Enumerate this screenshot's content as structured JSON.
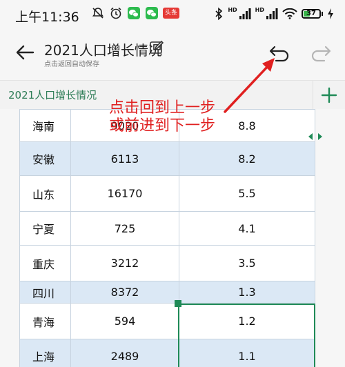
{
  "status_bar": {
    "time": "上午11:36",
    "app_badge": "头条",
    "signal1_label": "HD",
    "signal2_label": "HD",
    "battery_level": "37",
    "battery_fraction": 0.37,
    "icons": [
      "mute-bell-icon",
      "alarm-icon",
      "wechat-icon",
      "news-app-icon",
      "bluetooth-icon",
      "signal-icon",
      "wifi-icon",
      "battery-icon",
      "charging-icon"
    ]
  },
  "header": {
    "title": "2021人口增长情况",
    "subtitle": "点击返回自动保存"
  },
  "tabs": [
    {
      "label": "2021人口增长情况"
    }
  ],
  "table": {
    "rows": [
      {
        "name": "海南",
        "population": "9020",
        "rate": "8.8"
      },
      {
        "name": "安徽",
        "population": "6113",
        "rate": "8.2"
      },
      {
        "name": "山东",
        "population": "16170",
        "rate": "5.5"
      },
      {
        "name": "宁夏",
        "population": "725",
        "rate": "4.1"
      },
      {
        "name": "重庆",
        "population": "3212",
        "rate": "3.5"
      },
      {
        "name": "四川",
        "population": "8372",
        "rate": "1.3"
      },
      {
        "name": "青海",
        "population": "594",
        "rate": "1.2"
      },
      {
        "name": "上海",
        "population": "2489",
        "rate": "1.1"
      }
    ]
  },
  "annotation": {
    "line1": "点击回到上一步",
    "line2": "或前进到下一步"
  },
  "colors": {
    "accent": "#1f8a57",
    "annotation": "#e02020",
    "row_highlight": "#dbe8f5"
  }
}
